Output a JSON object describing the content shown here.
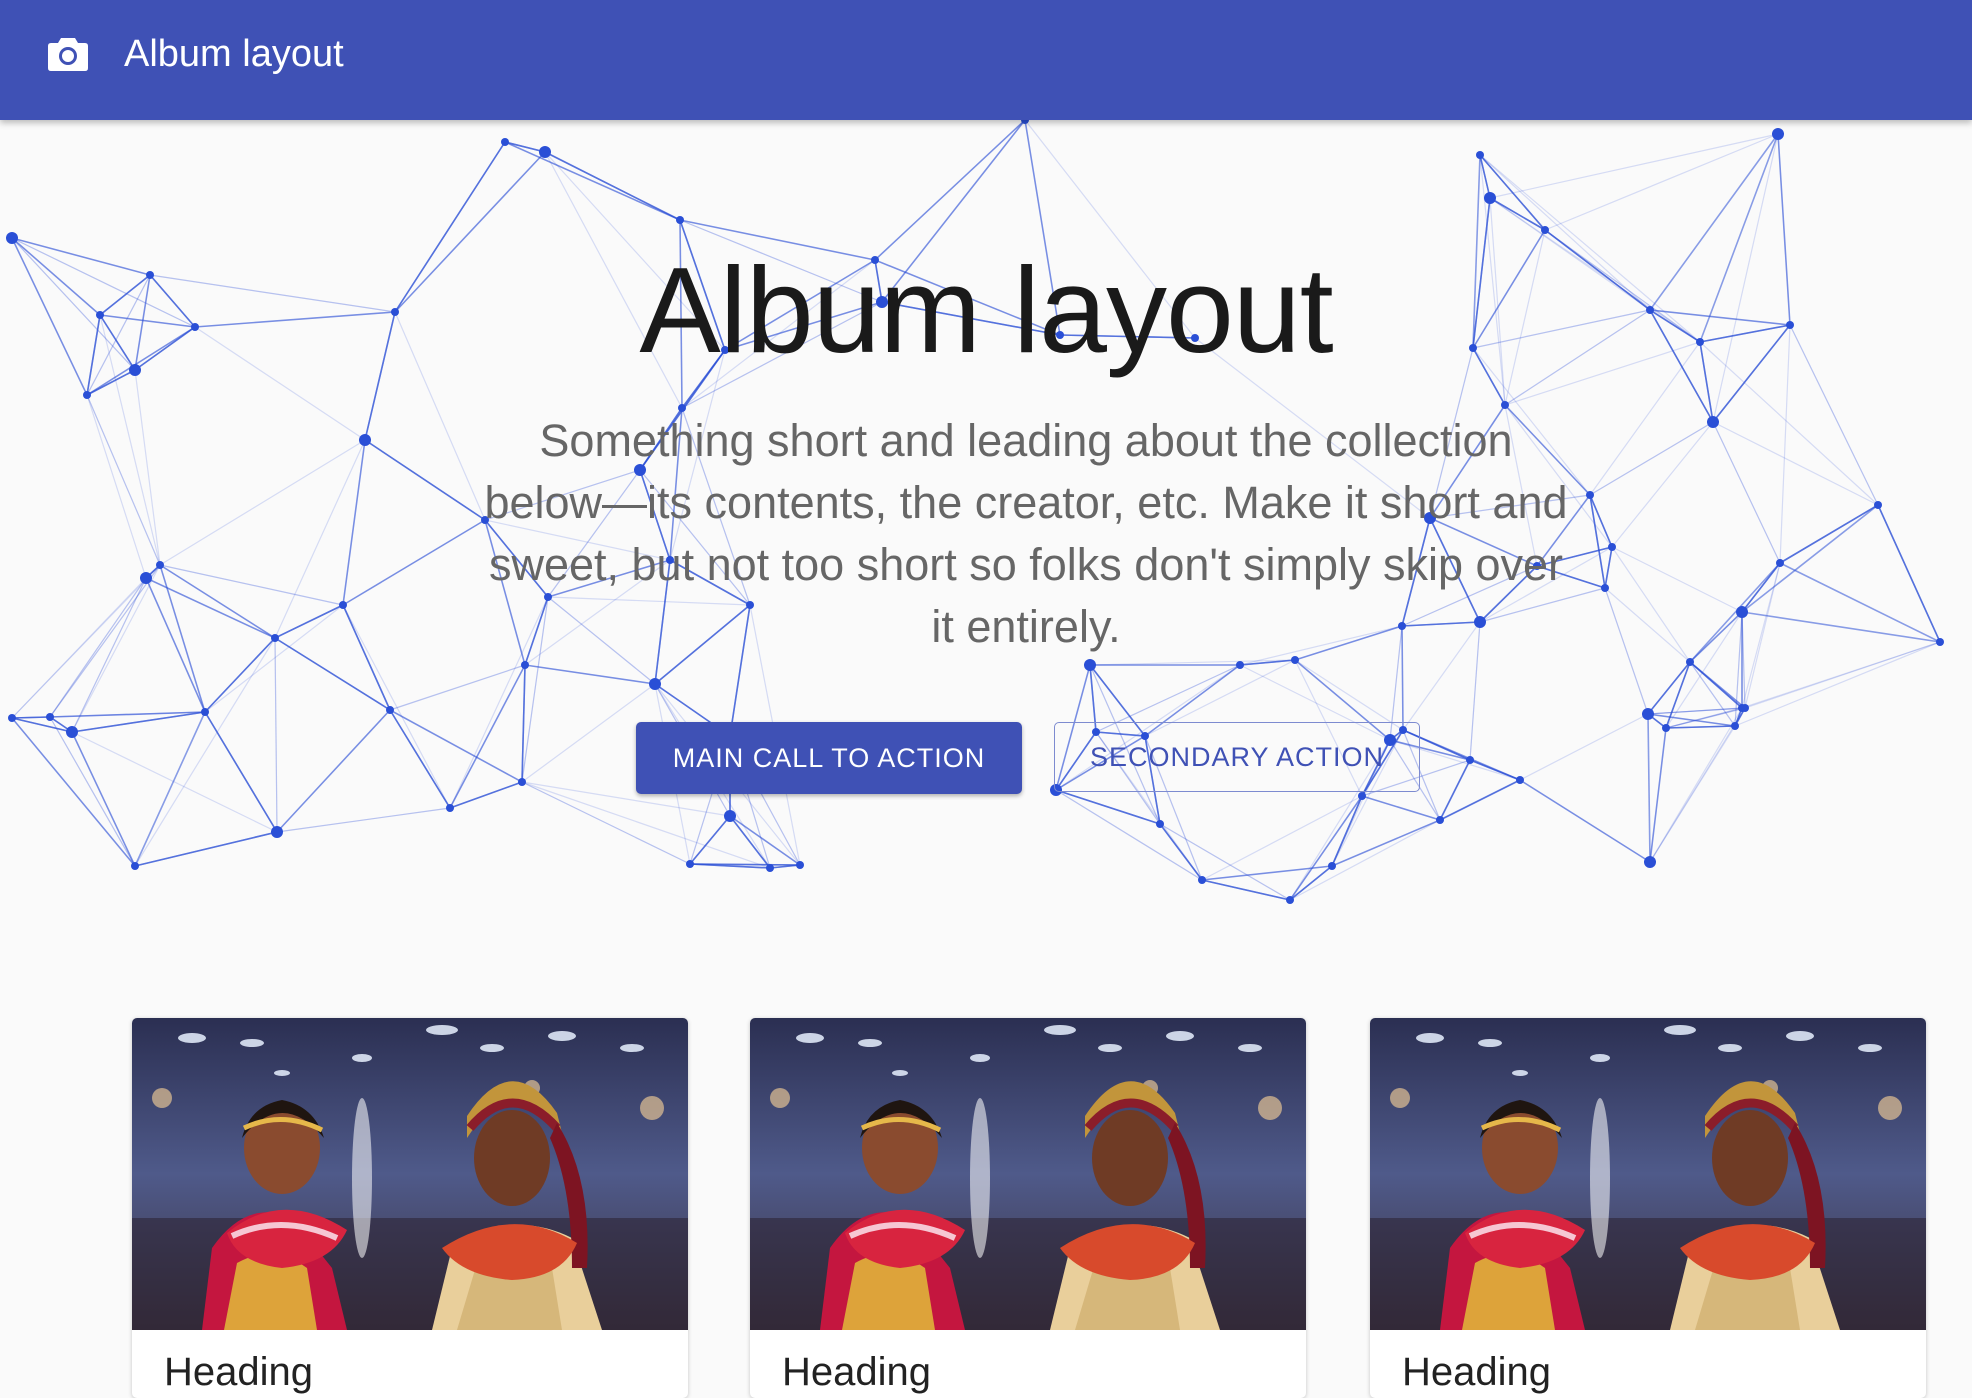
{
  "appbar": {
    "icon": "camera-icon",
    "title": "Album layout",
    "background": "#3f51b5"
  },
  "hero": {
    "title": "Album layout",
    "subtitle": "Something short and leading about the collection below—its contents, the creator, etc. Make it short and sweet, but not too short so folks don't simply skip over it entirely.",
    "primary_button": "MAIN CALL TO ACTION",
    "secondary_button": "SECONDARY ACTION",
    "network_color": "#2a4fd6"
  },
  "cards": [
    {
      "heading": "Heading",
      "image": "wedding-couple-image"
    },
    {
      "heading": "Heading",
      "image": "wedding-couple-image"
    },
    {
      "heading": "Heading",
      "image": "wedding-couple-image"
    }
  ]
}
